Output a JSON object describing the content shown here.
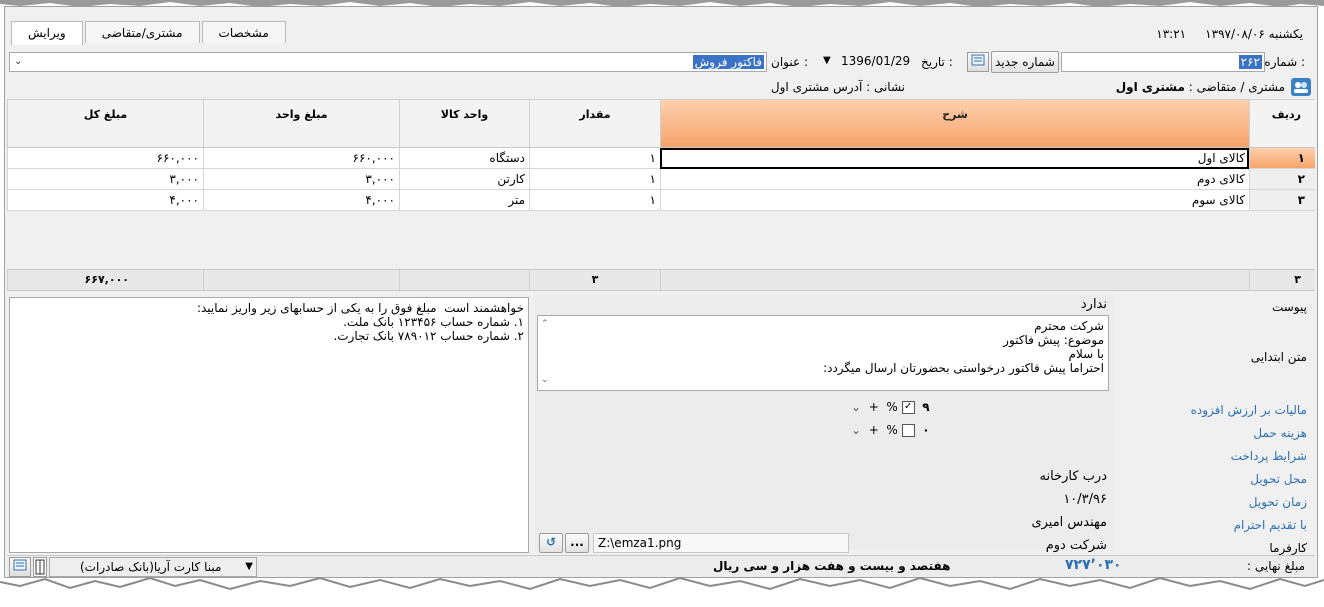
{
  "header": {
    "time": "۱۳:۲۱",
    "date": "یکشنبه ۱۳۹۷/۰۸/۰۶"
  },
  "tabs": [
    {
      "label": "ویرایش"
    },
    {
      "label": "مشتری/متقاضی"
    },
    {
      "label": "مشخصات"
    }
  ],
  "form": {
    "number_label": "شماره :",
    "number_value": "۲۶۲",
    "new_number_button": "شماره جدید",
    "date_label": "تاریخ :",
    "date_value": "1396/01/29",
    "title_label": "عنوان :",
    "title_value": "فاکتور فروش",
    "customer_label": "مشتری / متقاضی :",
    "customer_value": "مشتری اول",
    "address_label": "نشانی : آدرس مشتری اول"
  },
  "grid": {
    "columns": {
      "row": "ردیف",
      "desc": "شرح",
      "qty": "مقدار",
      "unit": "واحد کالا",
      "unit_price": "مبلغ واحد",
      "total": "مبلغ کل"
    },
    "rows": [
      {
        "idx": "۱",
        "desc": "کالای اول",
        "qty": "۱",
        "unit": "دستگاه",
        "unit_price": "۶۶۰,۰۰۰",
        "total": "۶۶۰,۰۰۰"
      },
      {
        "idx": "۲",
        "desc": "کالای دوم",
        "qty": "۱",
        "unit": "کارتن",
        "unit_price": "۳,۰۰۰",
        "total": "۳,۰۰۰"
      },
      {
        "idx": "۳",
        "desc": "کالای سوم",
        "qty": "۱",
        "unit": "متر",
        "unit_price": "۴,۰۰۰",
        "total": "۴,۰۰۰"
      }
    ],
    "totals": {
      "count": "۳",
      "qty": "۳",
      "total": "۶۶۷,۰۰۰"
    }
  },
  "notes": {
    "text": "خواهشمند است  مبلغ فوق را به یکی از حسابهای زیر واریز نمایید:\n۱. شماره حساب ۱۲۳۴۵۶ بانک ملت.\n۲. شماره حساب ۷۸۹۰۱۲ بانک تجارت."
  },
  "fields": {
    "attachment_label": "پیوست",
    "attachment_value": "ندارد",
    "intro_label": "متن ابتدایی",
    "intro_text": "شرکت محترم\nموضوع: پیش فاکتور\nبا سلام\nاحتراما پیش فاکتور درخواستی بحضورتان ارسال میگردد:",
    "vat_label": "مالیات بر ارزش افزوده",
    "vat_value": "۹",
    "shipping_label": "هزینه حمل",
    "shipping_value": "۰",
    "percent": "%",
    "plus": "+",
    "payment_label": "شرایط پرداخت",
    "delivery_place_label": "محل تحویل",
    "delivery_place_value": "درب کارخانه",
    "delivery_time_label": "زمان تحویل",
    "delivery_time_value": "۱۰/۳/۹۶",
    "regards_label": "با تقدیم احترام",
    "regards_value": "مهندس امیری",
    "employer_label": "کارفرما",
    "employer_value": "شرکت دوم",
    "signature_path": "Z:\\emza1.png",
    "browse_button": "..."
  },
  "status": {
    "bank_select": "مبنا کارت آریا(بانک صادرات)",
    "final_label": "مبلغ نهایی :",
    "final_value": "۷۲۷٬۰۳۰",
    "final_words": "هفتصد و بیست و هفت هزار و سی ریال"
  },
  "colors": {
    "accent_orange": "#f7a36b",
    "selection_blue": "#3a72c6",
    "label_blue": "#2b6fb3",
    "final_value_blue": "#2b6fb3"
  }
}
